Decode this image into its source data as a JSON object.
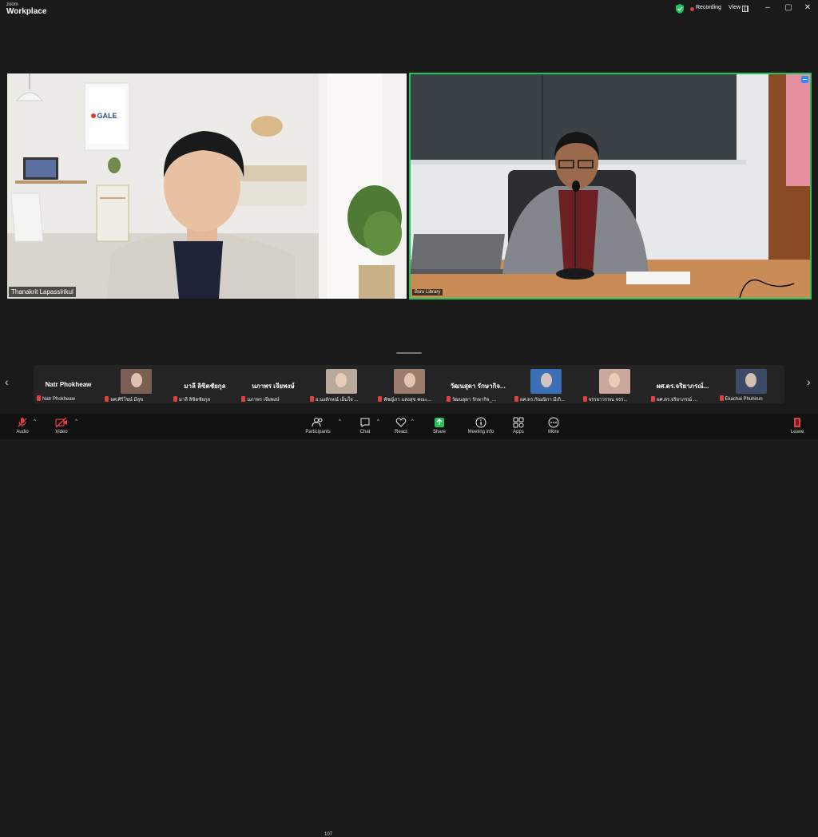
{
  "window": {
    "brand_small": "zoom",
    "brand_large": "Workplace",
    "recording_label": "Recording",
    "view_label": "View",
    "minimize": "–",
    "maximize": "▢",
    "close": "✕"
  },
  "videos": {
    "main_left": {
      "name": "Thanakrit Lapassirikul",
      "logo_text": "GALE"
    },
    "main_right": {
      "name": "Bsru Library"
    }
  },
  "strip": {
    "participants": [
      {
        "big_name": "Natr Phokheaw",
        "label": "Natr Phokheaw",
        "thumb": false
      },
      {
        "big_name": "",
        "label": "ผศ.ศิริโชน์ มีสุข",
        "thumb": true,
        "thumb_color": "#7a5f52"
      },
      {
        "big_name": "มาลี ลิขิตชัยกุล",
        "label": "มาลี ลิขิตชัยกุล",
        "thumb": false
      },
      {
        "big_name": "นภาพร เจียพงษ์",
        "label": "นภาพร เจียพงษ์",
        "thumb": false
      },
      {
        "big_name": "",
        "label": "อ.นงลักษณ์ เย็นใจ ...",
        "thumb": true,
        "thumb_color": "#b8a99a"
      },
      {
        "big_name": "",
        "label": "พัชญ์ภา แสงสุข คณะ...",
        "thumb": true,
        "thumb_color": "#9a7d6a"
      },
      {
        "big_name": "วัฒนสุดา รักษากิจ...",
        "label": "วัฒนสุดา รักษากิจ_...",
        "thumb": false
      },
      {
        "big_name": "",
        "label": "ผศ.ดร.กัณณิกา มีเกิ...",
        "thumb": true,
        "thumb_color": "#3a6fb5"
      },
      {
        "big_name": "",
        "label": "จรรยาวรรณ จรร...",
        "thumb": true,
        "thumb_color": "#c9a79b"
      },
      {
        "big_name": "ผศ.ดร.จริยาภรณ์...",
        "label": "ผศ.ดร.จริยาภรณ์ ...",
        "thumb": false
      },
      {
        "big_name": "",
        "label": "Ekachai Phuhirun",
        "thumb": true,
        "thumb_color": "#3b4a66"
      }
    ],
    "prev": "‹",
    "next": "›"
  },
  "toolbar": {
    "audio": "Audio",
    "video": "Video",
    "participants": "Participants",
    "participant_count": "107",
    "chat": "Chat",
    "react": "React",
    "share": "Share",
    "meeting_info": "Meeting info",
    "apps": "Apps",
    "more": "More",
    "leave": "Leave"
  },
  "colors": {
    "active_speaker_border": "#22c35b",
    "share_green": "#22c35b",
    "mute_red": "#e0413c",
    "leave_red": "#e0413c"
  }
}
